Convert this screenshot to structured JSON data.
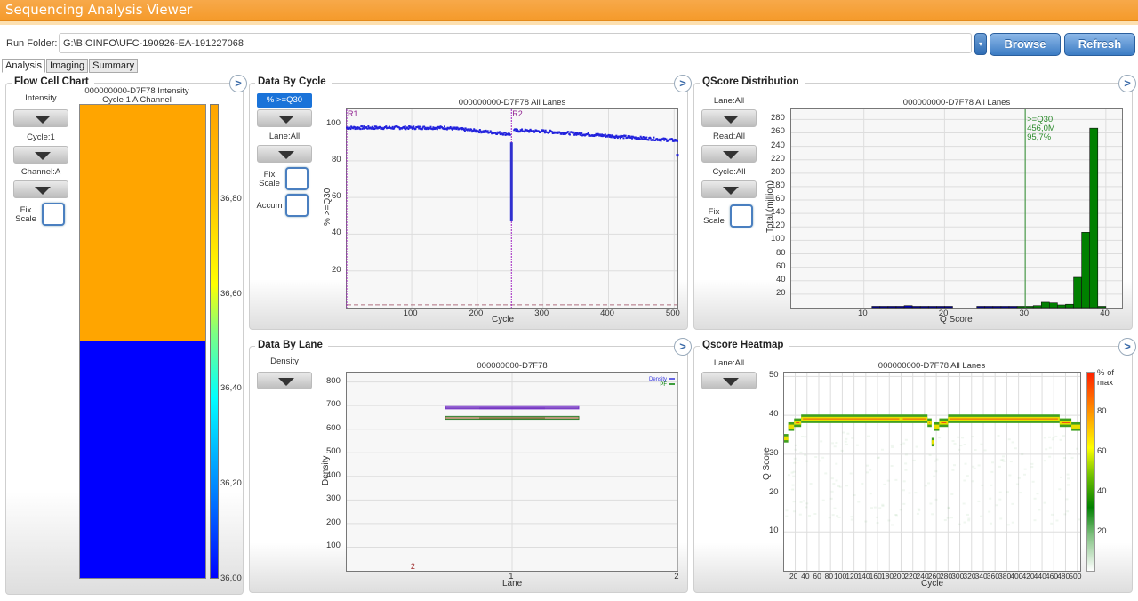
{
  "app": {
    "title": "Sequencing Analysis Viewer"
  },
  "run_folder": {
    "label": "Run Folder:",
    "value": "G:\\BIOINFO\\UFC-190926-EA-191227068"
  },
  "buttons": {
    "dropdown_icon": "▾",
    "browse": "Browse",
    "refresh": "Refresh"
  },
  "tabs": [
    {
      "label": "Analysis",
      "active": true
    },
    {
      "label": "Imaging",
      "active": false
    },
    {
      "label": "Summary",
      "active": false
    }
  ],
  "panels": {
    "expand_icon": ">",
    "flow_cell": {
      "title": "Flow Cell Chart",
      "controls": {
        "metric": "Intensity",
        "cycle": "Cycle:1",
        "channel": "Channel:A",
        "fix_scale": "Fix\nScale"
      },
      "colors": {
        "top_swath": "#FFA500",
        "bottom_swath": "#0000FF"
      }
    },
    "data_by_cycle": {
      "title": "Data By Cycle",
      "controls": {
        "metric": "% >=Q30",
        "lane": "Lane:All",
        "fix_scale": "Fix\nScale",
        "accum": "Accum"
      }
    },
    "qscore_dist": {
      "title": "QScore Distribution",
      "controls": {
        "lane": "Lane:All",
        "read": "Read:All",
        "cycle": "Cycle:All",
        "fix_scale": "Fix\nScale"
      }
    },
    "data_by_lane": {
      "title": "Data By Lane",
      "controls": {
        "metric": "Density"
      }
    },
    "qscore_heatmap": {
      "title": "Qscore Heatmap",
      "controls": {
        "lane": "Lane:All"
      }
    }
  },
  "chart_data": [
    {
      "id": "flow_cell",
      "type": "heatmap",
      "title": "000000000-D7F78 Intensity",
      "subtitle": "Cycle 1 A Channel",
      "cells": [
        {
          "region": "top",
          "value": 36.98
        },
        {
          "region": "bottom",
          "value": 36.0
        }
      ],
      "colorbar": {
        "range": [
          36.0,
          37.0
        ],
        "ticks": [
          "36,00",
          "36,20",
          "36,40",
          "36,60",
          "36,80"
        ]
      }
    },
    {
      "id": "data_by_cycle",
      "type": "scatter",
      "title": "000000000-D7F78 All Lanes",
      "xlabel": "Cycle",
      "ylabel": "% >=Q30",
      "xlim": [
        1,
        505
      ],
      "ylim": [
        0,
        108
      ],
      "xticks": [
        "100",
        "200",
        "300",
        "400",
        "500"
      ],
      "yticks": [
        "20",
        "40",
        "60",
        "80",
        "100"
      ],
      "read_markers": [
        {
          "label": "R1",
          "cycle": 1
        },
        {
          "label": "R2",
          "cycle": 252
        }
      ],
      "threshold_line": 1.5,
      "series_segments": [
        {
          "x_start": 1,
          "x_end": 150,
          "y_start": 98,
          "y_end": 98
        },
        {
          "x_start": 150,
          "x_end": 250,
          "y_start": 98,
          "y_end": 94.5
        },
        {
          "x_start": 256,
          "x_end": 300,
          "y_start": 96.5,
          "y_end": 96
        },
        {
          "x_start": 300,
          "x_end": 505,
          "y_start": 96,
          "y_end": 91
        }
      ],
      "dip": {
        "cycle": 252,
        "min": 47,
        "max": 90
      },
      "outlier": {
        "cycle": 505,
        "value": 83
      }
    },
    {
      "id": "qscore_dist",
      "type": "bar",
      "title": "000000000-D7F78 All Lanes",
      "xlabel": "Q Score",
      "ylabel": "Total (million)",
      "xlim": [
        1,
        42
      ],
      "ylim": [
        0,
        295
      ],
      "xticks": [
        "10",
        "20",
        "30",
        "40"
      ],
      "yticks": [
        "20",
        "40",
        "60",
        "80",
        "100",
        "120",
        "140",
        "160",
        "180",
        "200",
        "220",
        "240",
        "260",
        "280"
      ],
      "threshold": {
        "q": 30,
        "label": ">=Q30",
        "total": "456,0M",
        "percent": "95,7%"
      },
      "bins": [
        {
          "q": 12,
          "v": 1
        },
        {
          "q": 13,
          "v": 1
        },
        {
          "q": 14,
          "v": 2
        },
        {
          "q": 15,
          "v": 2
        },
        {
          "q": 16,
          "v": 3
        },
        {
          "q": 17,
          "v": 1.5
        },
        {
          "q": 18,
          "v": 1
        },
        {
          "q": 19,
          "v": 0.5
        },
        {
          "q": 20,
          "v": 0.5
        },
        {
          "q": 21,
          "v": 0.5
        },
        {
          "q": 25,
          "v": 0.5
        },
        {
          "q": 26,
          "v": 0.5
        },
        {
          "q": 27,
          "v": 1
        },
        {
          "q": 28,
          "v": 1
        },
        {
          "q": 29,
          "v": 1
        },
        {
          "q": 30,
          "v": 1
        },
        {
          "q": 31,
          "v": 1
        },
        {
          "q": 32,
          "v": 3
        },
        {
          "q": 33,
          "v": 8
        },
        {
          "q": 34,
          "v": 7
        },
        {
          "q": 35,
          "v": 4
        },
        {
          "q": 36,
          "v": 5
        },
        {
          "q": 37,
          "v": 45
        },
        {
          "q": 38,
          "v": 112
        },
        {
          "q": 39,
          "v": 267
        },
        {
          "q": 40,
          "v": 1
        }
      ],
      "colors": {
        "below": "#0000B0",
        "above": "#008000"
      }
    },
    {
      "id": "data_by_lane",
      "type": "box",
      "title": "000000000-D7F78",
      "xlabel": "Lane",
      "ylabel": "Density",
      "xlim": [
        0,
        2
      ],
      "ylim": [
        0,
        840
      ],
      "xticks": [
        "1",
        "2"
      ],
      "yticks": [
        "100",
        "200",
        "300",
        "400",
        "500",
        "600",
        "700",
        "800"
      ],
      "legend": {
        "position": "top-right",
        "entries": [
          {
            "name": "Density",
            "color": "#3333DD"
          },
          {
            "name": "PF",
            "color": "#008000"
          }
        ]
      },
      "series": [
        {
          "name": "Density",
          "lane": 1,
          "low": 686,
          "q1": 688,
          "median": 690,
          "q3": 692,
          "high": 696,
          "color": "#8040D0"
        },
        {
          "name": "PF",
          "lane": 1,
          "low": 642,
          "q1": 645,
          "median": 648,
          "q3": 651,
          "high": 654,
          "color": "#308030"
        }
      ],
      "annotation": {
        "text": "2",
        "x": 0.4
      }
    },
    {
      "id": "qscore_heatmap",
      "type": "heatmap",
      "title": "000000000-D7F78 All Lanes",
      "xlabel": "Cycle",
      "ylabel": "Q Score",
      "xlim": [
        1,
        505
      ],
      "ylim": [
        0,
        51
      ],
      "xticks": [
        "20",
        "40",
        "60",
        "80",
        "100",
        "120",
        "140",
        "160",
        "180",
        "200",
        "220",
        "240",
        "260",
        "280",
        "300",
        "320",
        "340",
        "360",
        "380",
        "400",
        "420",
        "440",
        "460",
        "480",
        "500"
      ],
      "yticks": [
        "10",
        "20",
        "30",
        "40",
        "50"
      ],
      "colorbar": {
        "label": "% of max",
        "ticks": [
          "20",
          "40",
          "60",
          "80"
        ]
      },
      "profile": [
        {
          "c_start": 1,
          "c_end": 8,
          "q": 34
        },
        {
          "c_start": 8,
          "c_end": 18,
          "q": 37
        },
        {
          "c_start": 18,
          "c_end": 30,
          "q": 38
        },
        {
          "c_start": 30,
          "c_end": 200,
          "q": 39
        },
        {
          "c_start": 200,
          "c_end": 245,
          "q": 39
        },
        {
          "c_start": 245,
          "c_end": 252,
          "q": 38
        },
        {
          "c_start": 252,
          "c_end": 256,
          "q": 33
        },
        {
          "c_start": 256,
          "c_end": 265,
          "q": 37
        },
        {
          "c_start": 265,
          "c_end": 280,
          "q": 38
        },
        {
          "c_start": 280,
          "c_end": 470,
          "q": 39
        },
        {
          "c_start": 470,
          "c_end": 490,
          "q": 38
        },
        {
          "c_start": 490,
          "c_end": 505,
          "q": 37
        }
      ]
    }
  ]
}
